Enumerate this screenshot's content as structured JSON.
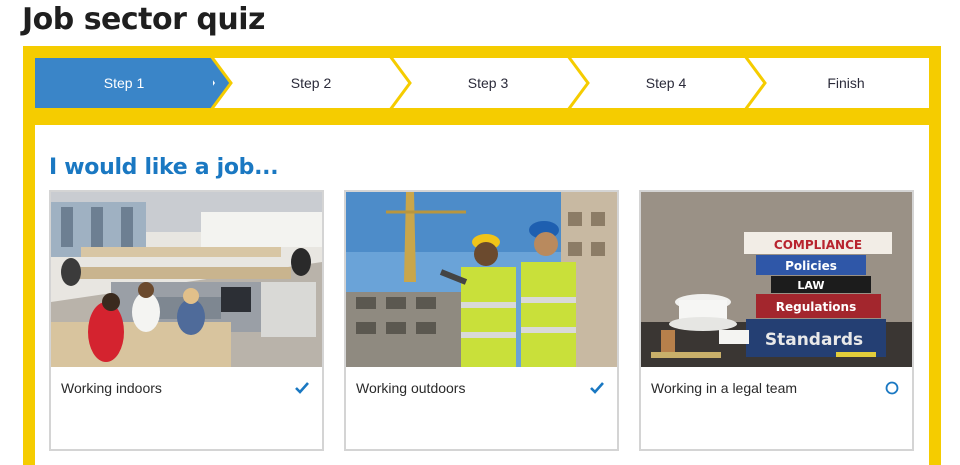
{
  "page": {
    "title": "Job sector quiz"
  },
  "stepper": {
    "steps": [
      {
        "label": "Step 1",
        "state": "active"
      },
      {
        "label": "Step 2",
        "state": "pending"
      },
      {
        "label": "Step 3",
        "state": "pending"
      },
      {
        "label": "Step 4",
        "state": "pending"
      },
      {
        "label": "Finish",
        "state": "pending"
      }
    ]
  },
  "panel": {
    "heading": "I would like a job...",
    "cards": [
      {
        "label": "Working indoors",
        "selected": true,
        "image": "office-photo"
      },
      {
        "label": "Working outdoors",
        "selected": true,
        "image": "construction-photo"
      },
      {
        "label": "Working in a legal team",
        "selected": false,
        "image": "legal-books-photo"
      }
    ],
    "book_titles": [
      "COMPLIANCE",
      "Policies",
      "LAW",
      "Regulations",
      "Standards"
    ]
  },
  "colors": {
    "frame": "#f5cc00",
    "active_step": "#3a85c8",
    "heading": "#1a78c2",
    "check": "#1a78c2"
  }
}
